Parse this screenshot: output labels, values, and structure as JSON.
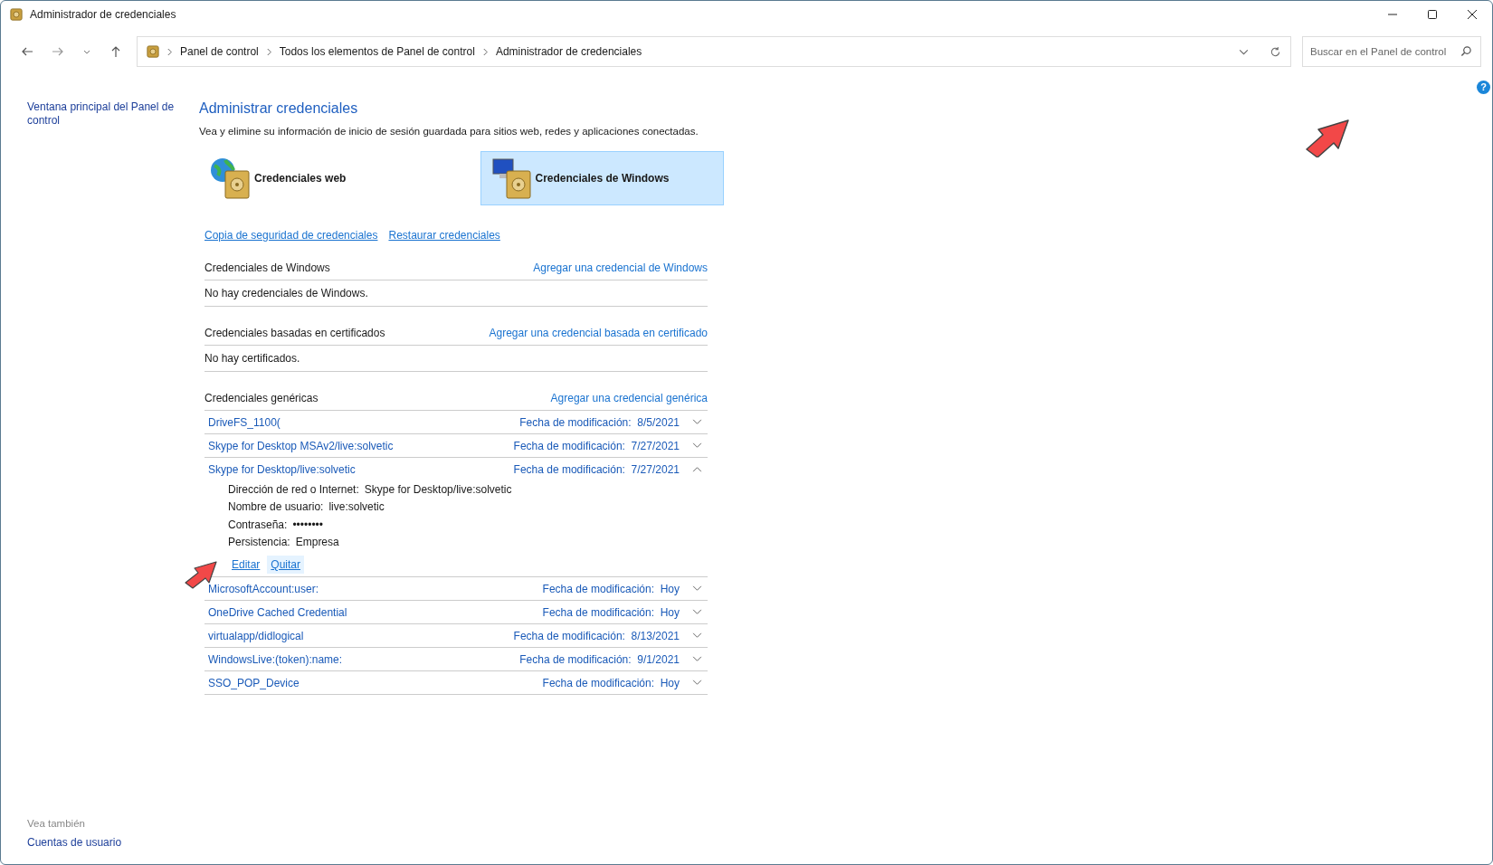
{
  "window": {
    "title": "Administrador de credenciales"
  },
  "address_bar": {
    "breadcrumbs": [
      "Panel de control",
      "Todos los elementos de Panel de control",
      "Administrador de credenciales"
    ]
  },
  "search": {
    "placeholder": "Buscar en el Panel de control"
  },
  "help_button": {
    "label": "?"
  },
  "sidebar": {
    "main_link": "Ventana principal del Panel de control",
    "see_also_label": "Vea también",
    "see_also_links": [
      "Cuentas de usuario"
    ]
  },
  "page": {
    "title": "Administrar credenciales",
    "description": "Vea y elimine su información de inicio de sesión guardada para sitios web, redes y aplicaciones conectadas.",
    "tiles": [
      {
        "kind": "web",
        "label": "Credenciales web",
        "selected": false
      },
      {
        "kind": "windows",
        "label": "Credenciales de Windows",
        "selected": true
      }
    ],
    "actions": [
      "Copia de seguridad de credenciales",
      "Restaurar credenciales"
    ],
    "sections": [
      {
        "title": "Credenciales de Windows",
        "add_link": "Agregar una credencial de Windows",
        "empty_text": "No hay credenciales de Windows."
      },
      {
        "title": "Credenciales basadas en certificados",
        "add_link": "Agregar una credencial basada en certificado",
        "empty_text": "No hay certificados."
      },
      {
        "title": "Credenciales genéricas",
        "add_link": "Agregar una credencial genérica",
        "items": [
          {
            "name": "DriveFS_1100(",
            "date_label": "Fecha de modificación:",
            "date": "8/5/2021",
            "expanded": false
          },
          {
            "name": "Skype for Desktop MSAv2/live:solvetic",
            "date_label": "Fecha de modificación:",
            "date": "7/27/2021",
            "expanded": false
          },
          {
            "name": "Skype for Desktop/live:solvetic",
            "date_label": "Fecha de modificación:",
            "date": "7/27/2021",
            "expanded": true,
            "details": [
              {
                "label": "Dirección de red o Internet:",
                "value": "Skype for Desktop/live:solvetic"
              },
              {
                "label": "Nombre de usuario:",
                "value": "live:solvetic"
              },
              {
                "label": "Contraseña:",
                "value": "••••••••"
              },
              {
                "label": "Persistencia:",
                "value": "Empresa"
              }
            ],
            "buttons": [
              "Editar",
              "Quitar"
            ]
          },
          {
            "name": "MicrosoftAccount:user:",
            "date_label": "Fecha de modificación:",
            "date": "Hoy",
            "expanded": false
          },
          {
            "name": "OneDrive Cached Credential",
            "date_label": "Fecha de modificación:",
            "date": "Hoy",
            "expanded": false
          },
          {
            "name": "virtualapp/didlogical",
            "date_label": "Fecha de modificación:",
            "date": "8/13/2021",
            "expanded": false
          },
          {
            "name": "WindowsLive:(token):name:",
            "date_label": "Fecha de modificación:",
            "date": "9/1/2021",
            "expanded": false
          },
          {
            "name": "SSO_POP_Device",
            "date_label": "Fecha de modificación:",
            "date": "Hoy",
            "expanded": false
          }
        ]
      }
    ]
  }
}
